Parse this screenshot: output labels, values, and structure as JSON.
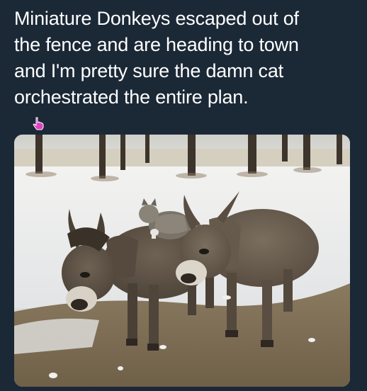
{
  "post": {
    "caption_lines": [
      "Miniature Donkeys escaped out of",
      "the fence and are heading to town",
      "and I'm pretty sure the damn cat",
      "orchestrated the entire plan."
    ]
  },
  "photo": {
    "subjects": [
      "donkey",
      "donkey",
      "cat"
    ],
    "scene": "snowy-field-with-trees"
  },
  "colors": {
    "background": "#1b2836",
    "caption_text": "#ffffff",
    "cursor": "#e040c0"
  },
  "icons": {
    "cursor": "hand-pointer-icon"
  }
}
